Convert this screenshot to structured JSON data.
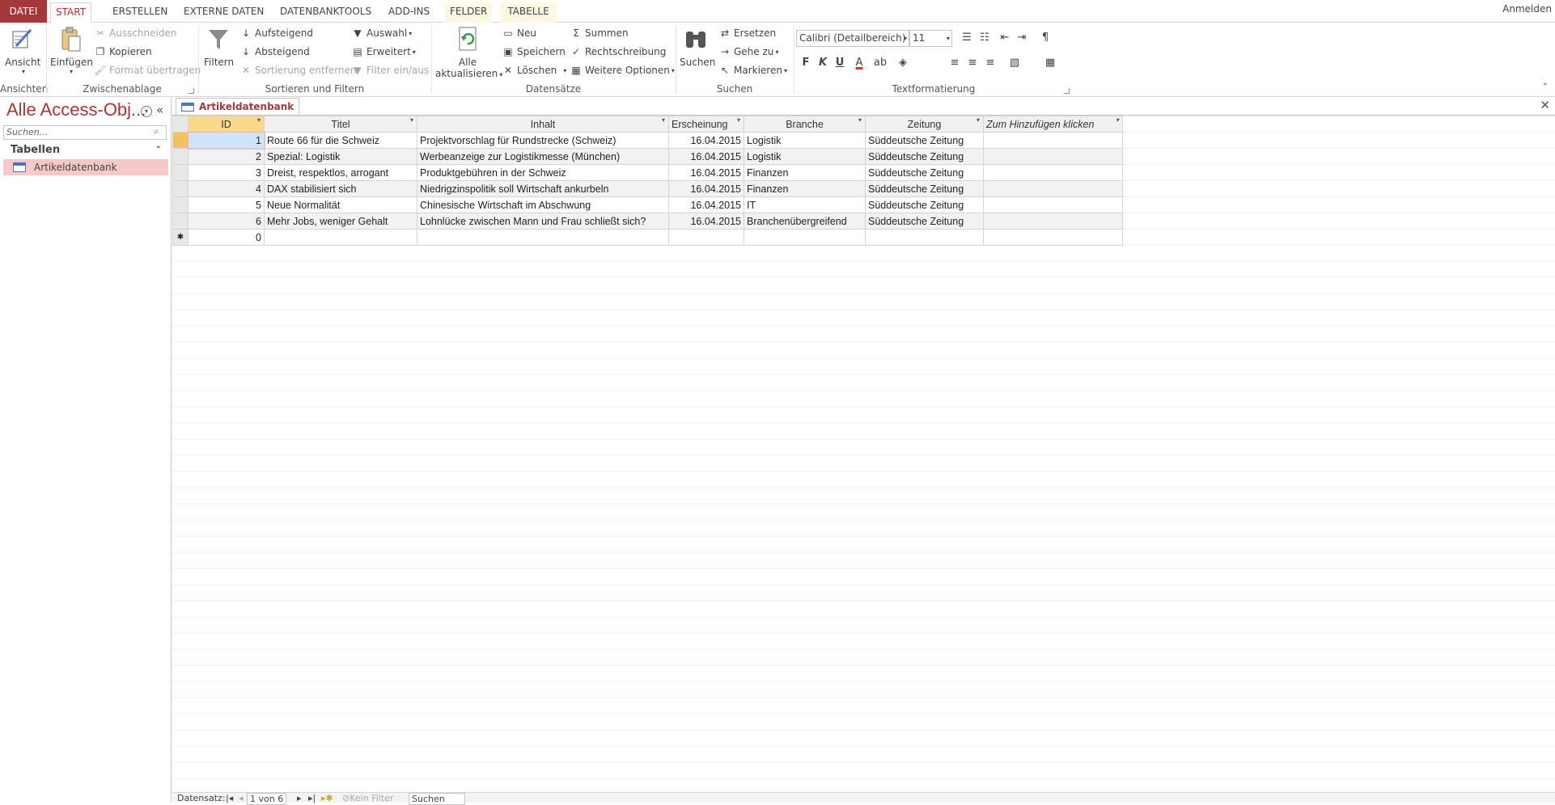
{
  "ribbon_tabs": {
    "datei": "DATEI",
    "start": "START",
    "erstellen": "ERSTELLEN",
    "externe": "EXTERNE DATEN",
    "dbtools": "DATENBANKTOOLS",
    "addins": "ADD-INS",
    "felder": "FELDER",
    "tabelle": "TABELLE"
  },
  "signin": "Anmelden",
  "groups": {
    "ansichten": {
      "label": "Ansichten",
      "ansicht": "Ansicht"
    },
    "zwischenablage": {
      "label": "Zwischenablage",
      "einfuegen": "Einfügen",
      "ausschneiden": "Ausschneiden",
      "kopieren": "Kopieren",
      "format": "Format übertragen"
    },
    "sortieren": {
      "label": "Sortieren und Filtern",
      "filtern": "Filtern",
      "aufsteigend": "Aufsteigend",
      "absteigend": "Absteigend",
      "sortierung": "Sortierung entfernen",
      "auswahl": "Auswahl",
      "erweitert": "Erweitert",
      "filter": "Filter ein/aus"
    },
    "datensaetze": {
      "label": "Datensätze",
      "alle": "Alle",
      "aktualisieren": "aktualisieren",
      "neu": "Neu",
      "speichern": "Speichern",
      "loeschen": "Löschen",
      "summen": "Summen",
      "rechtschreibung": "Rechtschreibung",
      "weitere": "Weitere Optionen"
    },
    "suchen": {
      "label": "Suchen",
      "suchen": "Suchen",
      "ersetzen": "Ersetzen",
      "gehezu": "Gehe zu",
      "markieren": "Markieren"
    },
    "text": {
      "label": "Textformatierung",
      "font": "Calibri (Detailbereich)",
      "size": "11",
      "bold": "F",
      "italic": "K",
      "underline": "U"
    }
  },
  "nav": {
    "title": "Alle Access-Obj...",
    "search_placeholder": "Suchen...",
    "section": "Tabellen",
    "item": "Artikeldatenbank"
  },
  "doc": {
    "tab": "Artikeldatenbank"
  },
  "table": {
    "columns": [
      "ID",
      "Titel",
      "Inhalt",
      "Erscheinung",
      "Branche",
      "Zeitung",
      "Zum Hinzufügen klicken"
    ],
    "rows": [
      [
        "1",
        "Route 66 für die Schweiz",
        "Projektvorschlag für Rundstrecke (Schweiz)",
        "16.04.2015",
        "Logistik",
        "Süddeutsche Zeitung"
      ],
      [
        "2",
        "Spezial: Logistik",
        "Werbeanzeige zur Logistikmesse (München)",
        "16.04.2015",
        "Logistik",
        "Süddeutsche Zeitung"
      ],
      [
        "3",
        "Dreist, respektlos, arrogant",
        "Produktgebühren in der Schweiz",
        "16.04.2015",
        "Finanzen",
        "Süddeutsche Zeitung"
      ],
      [
        "4",
        "DAX stabilisiert sich",
        "Niedrigzinspolitik soll Wirtschaft ankurbeln",
        "16.04.2015",
        "Finanzen",
        "Süddeutsche Zeitung"
      ],
      [
        "5",
        "Neue Normalität",
        "Chinesische Wirtschaft im Abschwung",
        "16.04.2015",
        "IT",
        "Süddeutsche Zeitung"
      ],
      [
        "6",
        "Mehr Jobs, weniger Gehalt",
        "Lohnlücke zwischen Mann und Frau schließt sich?",
        "16.04.2015",
        "Branchenübergreifend",
        "Süddeutsche Zeitung"
      ]
    ],
    "new_row_id": "0",
    "new_row_marker": "✱"
  },
  "status": {
    "label": "Datensatz:",
    "record": "1 von 6",
    "filter": "Kein Filter",
    "search": "Suchen"
  }
}
